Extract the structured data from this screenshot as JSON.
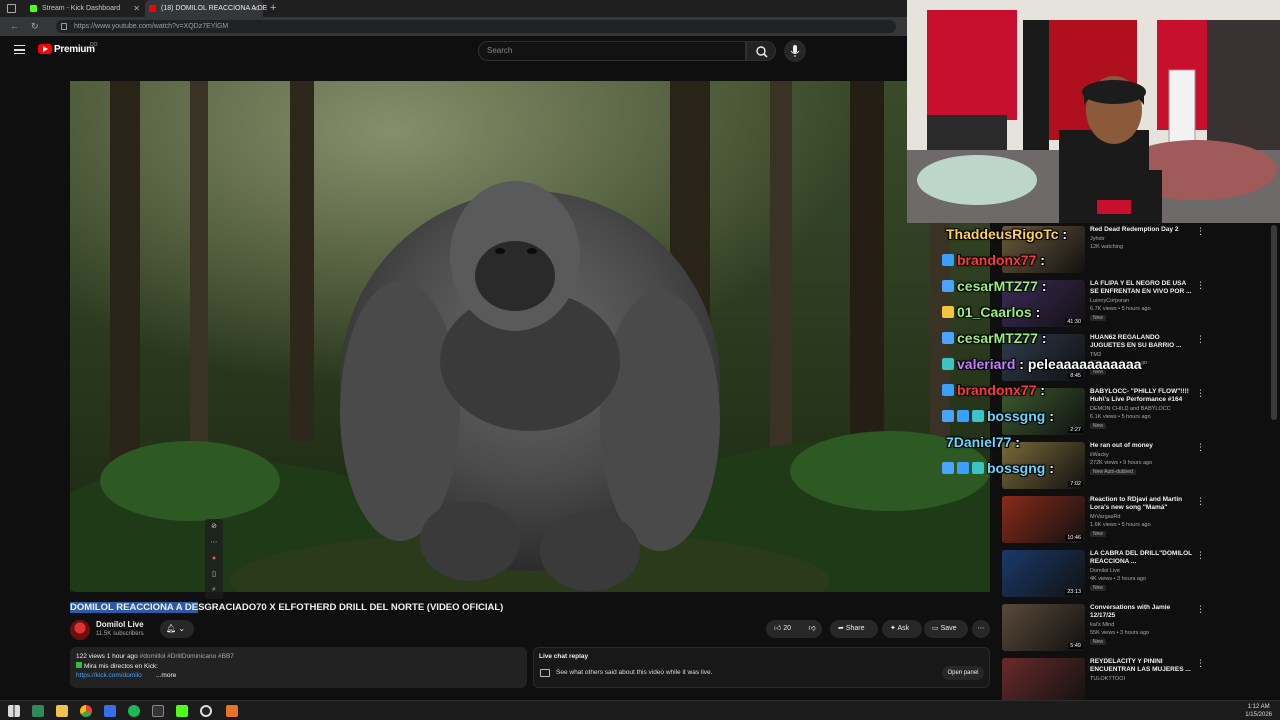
{
  "browser": {
    "tabs": [
      {
        "label": "Stream - Kick Dashboard",
        "icon": "kick-icon",
        "color": "#53fc18"
      },
      {
        "label": "(18) DOMILOL REACCIONA A DE",
        "icon": "youtube-icon",
        "color": "#ff0000"
      }
    ],
    "new_tab": "+",
    "url": "https://www.youtube.com/watch?v=XQDz7EYlGM"
  },
  "youtube": {
    "logo_text": "Premium",
    "logo_sup": "DO",
    "search_placeholder": "Search"
  },
  "video": {
    "title_selected": "DOMILOL REACCIONA A DE",
    "title_rest": "SGRACIADO70 X ELFOTHERD DRILL DEL NORTE (VIDEO OFICIAL)",
    "channel": "Domilol Live",
    "subscribers": "11.5K subscribers",
    "likes": "20",
    "share": "Share",
    "ask": "Ask",
    "save": "Save"
  },
  "description": {
    "stats": "122 views  1 hour ago",
    "tags": "#domillol #DrillDominicano #BB7",
    "line2": "Mira mis directos en Kick:",
    "link": "https://kick.com/domilo",
    "more": "...more"
  },
  "live_chat_replay": {
    "title": "Live chat replay",
    "subtitle": "See what others said about this video while it was live.",
    "button": "Open panel"
  },
  "overlay_chat": [
    {
      "user": "ThaddeusRigoTc",
      "msg": "",
      "color": "#ffd54a",
      "badges": []
    },
    {
      "user": "brandonx77",
      "msg": "",
      "color": "#ff3b3b",
      "badges": [
        "#3aa0ff"
      ]
    },
    {
      "user": "cesarMTZ77",
      "msg": "",
      "color": "#9cf07a",
      "badges": [
        "#4aa3ff"
      ]
    },
    {
      "user": "01_Caarlos",
      "msg": "",
      "color": "#9cf07a",
      "badges": [
        "#f5c542"
      ]
    },
    {
      "user": "cesarMTZ77",
      "msg": "",
      "color": "#9cf07a",
      "badges": [
        "#4aa3ff"
      ]
    },
    {
      "user": "valeriard",
      "msg": "peleaaaaaaaaaaa",
      "color": "#c77dff",
      "badges": [
        "#3cc3c3"
      ]
    },
    {
      "user": "brandonx77",
      "msg": "",
      "color": "#ff3b3b",
      "badges": [
        "#3aa0ff"
      ]
    },
    {
      "user": "bossgng",
      "msg": "",
      "color": "#66d9ff",
      "badges": [
        "#4aa3ff",
        "#3aa0ff",
        "#3cc3c3"
      ]
    },
    {
      "user": "7Daniel77",
      "msg": "",
      "color": "#66d9ff",
      "badges": []
    },
    {
      "user": "bossgng",
      "msg": "",
      "color": "#66d9ff",
      "badges": [
        "#4aa3ff",
        "#3aa0ff",
        "#3cc3c3"
      ]
    }
  ],
  "recommendations": [
    {
      "title": "Red Dead Redemption Day 2",
      "channel": "Jyhxtr",
      "meta": "12K watching",
      "badge": "",
      "duration": "",
      "thumb": "#6b5a3c"
    },
    {
      "title": "LA FLIPA Y EL NEGRO DE USA SE ENFRENTAN EN VIVO POR ...",
      "channel": "LuinnyCorporan",
      "meta": "6.7K views • 5 hours ago",
      "badge": "New",
      "duration": "41:30",
      "thumb": "#3d2a5a"
    },
    {
      "title": "HUAN62 REGALANDO JUGUETES EN SU BARRIO ...",
      "channel": "TM3",
      "meta": "26K views • 4 days ago",
      "badge": "New",
      "duration": "8:45",
      "thumb": "#2f3b4d"
    },
    {
      "title": "BABYLOCC- \"PHILLY FLOW\"!!!! Huh\\'s Live Performance #164",
      "channel": "DEMON CHILD and BABYLOCC",
      "meta": "6.1K views • 5 hours ago",
      "badge": "New",
      "duration": "2:27",
      "thumb": "#3c5a2f"
    },
    {
      "title": "He ran out of money",
      "channel": "iiWacky",
      "meta": "272K views • 9 hours ago",
      "badge": "New  Auto-dubbed",
      "duration": "7:02",
      "thumb": "#7a6a3a"
    },
    {
      "title": "Reaction to RDjavi and Martin Lora's new song \"Mamá\"",
      "channel": "MrVargasRd",
      "meta": "1.6K views • 5 hours ago",
      "badge": "New",
      "duration": "10:46",
      "thumb": "#8a2a1a"
    },
    {
      "title": "LA CABRA DEL DRILL\"DOMILOL REACCIONA ...",
      "channel": "Domilol Live",
      "meta": "4K views • 3 hours ago",
      "badge": "New",
      "duration": "23:13",
      "thumb": "#1a3a6a"
    },
    {
      "title": "Conversations with Jamie 12/17/25",
      "channel": "kai's Mind",
      "meta": "55K views • 3 hours ago",
      "badge": "New",
      "duration": "5:49",
      "thumb": "#5a4a3a"
    },
    {
      "title": "REYDELACITY Y PININI ENCUENTRAN LAS MUJERES ...",
      "channel": "TULOKTTOOI",
      "meta": "",
      "badge": "",
      "duration": "",
      "thumb": "#6a2a2a"
    }
  ],
  "taskbar": {
    "time": "1:12 AM",
    "date": "1/15/2026"
  }
}
